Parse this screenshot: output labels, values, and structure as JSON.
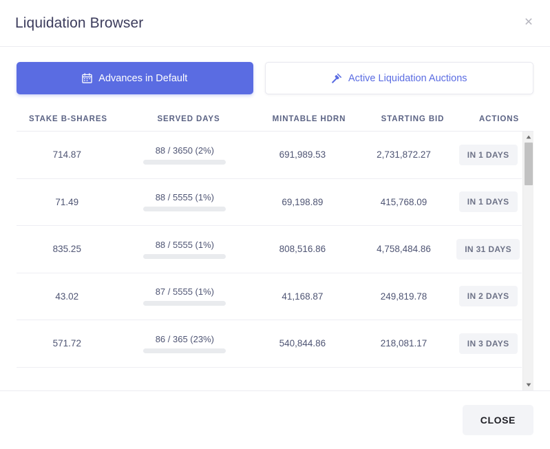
{
  "modal": {
    "title": "Liquidation Browser",
    "close_icon": "close-x-icon",
    "footer_close_label": "CLOSE"
  },
  "tabs": [
    {
      "label": "Advances in Default",
      "icon": "calendar-icon",
      "active": true
    },
    {
      "label": "Active Liquidation Auctions",
      "icon": "gavel-icon",
      "active": false
    }
  ],
  "table": {
    "columns": [
      "STAKE B-SHARES",
      "SERVED DAYS",
      "MINTABLE HDRN",
      "STARTING BID",
      "ACTIONS"
    ],
    "rows": [
      {
        "stake_b_shares": "714.87",
        "served_days": "88 / 3650 (2%)",
        "served_pct": 2,
        "mintable_hdrn": "691,989.53",
        "starting_bid": "2,731,872.27",
        "action": "IN 1 DAYS"
      },
      {
        "stake_b_shares": "71.49",
        "served_days": "88 / 5555 (1%)",
        "served_pct": 1,
        "mintable_hdrn": "69,198.89",
        "starting_bid": "415,768.09",
        "action": "IN 1 DAYS"
      },
      {
        "stake_b_shares": "835.25",
        "served_days": "88 / 5555 (1%)",
        "served_pct": 1,
        "mintable_hdrn": "808,516.86",
        "starting_bid": "4,758,484.86",
        "action": "IN 31 DAYS"
      },
      {
        "stake_b_shares": "43.02",
        "served_days": "87 / 5555 (1%)",
        "served_pct": 1,
        "mintable_hdrn": "41,168.87",
        "starting_bid": "249,819.78",
        "action": "IN 2 DAYS"
      },
      {
        "stake_b_shares": "571.72",
        "served_days": "86 / 365 (23%)",
        "served_pct": 23,
        "mintable_hdrn": "540,844.86",
        "starting_bid": "218,081.17",
        "action": "IN 3 DAYS"
      }
    ]
  },
  "scrollbar": {
    "up_icon": "scroll-up-arrow-icon",
    "down_icon": "scroll-down-arrow-icon"
  },
  "colors": {
    "accent_blue": "#5a6ce2",
    "progress_green": "#2dd08a",
    "badge_bg": "#f3f4f7",
    "text_primary": "#4e5473",
    "header_text": "#5b6384"
  }
}
